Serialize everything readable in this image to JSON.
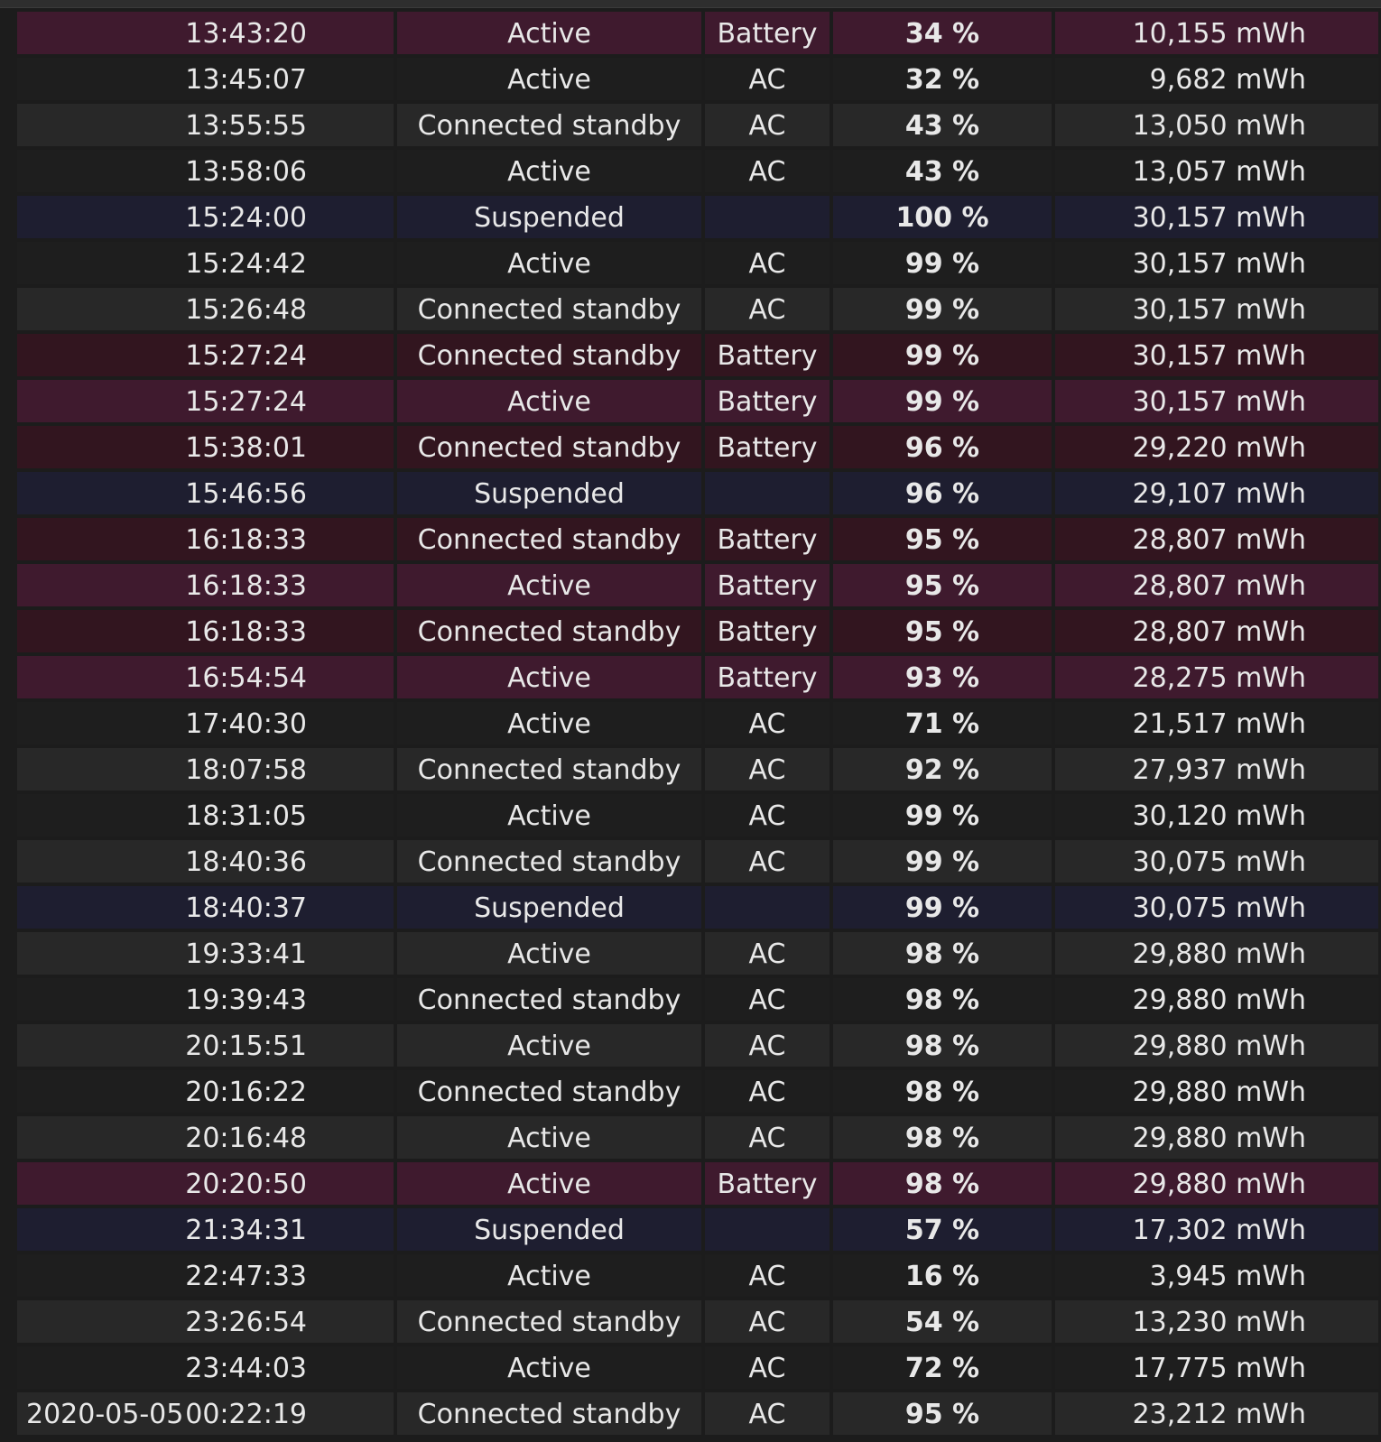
{
  "colors": {
    "battery_active": "#3f1a2e",
    "battery_standby": "#32151f",
    "suspended": "#1e1e30",
    "ac_light": "#282828",
    "ac_dark": "#1e1e1e",
    "text": "#e8e8e8"
  },
  "rows": [
    {
      "date": "",
      "time": "13:43:20",
      "state": "Active",
      "source": "Battery",
      "percent": "34 %",
      "capacity": "10,155 mWh"
    },
    {
      "date": "",
      "time": "13:45:07",
      "state": "Active",
      "source": "AC",
      "percent": "32 %",
      "capacity": "9,682 mWh"
    },
    {
      "date": "",
      "time": "13:55:55",
      "state": "Connected standby",
      "source": "AC",
      "percent": "43 %",
      "capacity": "13,050 mWh"
    },
    {
      "date": "",
      "time": "13:58:06",
      "state": "Active",
      "source": "AC",
      "percent": "43 %",
      "capacity": "13,057 mWh"
    },
    {
      "date": "",
      "time": "15:24:00",
      "state": "Suspended",
      "source": "",
      "percent": "100 %",
      "capacity": "30,157 mWh"
    },
    {
      "date": "",
      "time": "15:24:42",
      "state": "Active",
      "source": "AC",
      "percent": "99 %",
      "capacity": "30,157 mWh"
    },
    {
      "date": "",
      "time": "15:26:48",
      "state": "Connected standby",
      "source": "AC",
      "percent": "99 %",
      "capacity": "30,157 mWh"
    },
    {
      "date": "",
      "time": "15:27:24",
      "state": "Connected standby",
      "source": "Battery",
      "percent": "99 %",
      "capacity": "30,157 mWh"
    },
    {
      "date": "",
      "time": "15:27:24",
      "state": "Active",
      "source": "Battery",
      "percent": "99 %",
      "capacity": "30,157 mWh"
    },
    {
      "date": "",
      "time": "15:38:01",
      "state": "Connected standby",
      "source": "Battery",
      "percent": "96 %",
      "capacity": "29,220 mWh"
    },
    {
      "date": "",
      "time": "15:46:56",
      "state": "Suspended",
      "source": "",
      "percent": "96 %",
      "capacity": "29,107 mWh"
    },
    {
      "date": "",
      "time": "16:18:33",
      "state": "Connected standby",
      "source": "Battery",
      "percent": "95 %",
      "capacity": "28,807 mWh"
    },
    {
      "date": "",
      "time": "16:18:33",
      "state": "Active",
      "source": "Battery",
      "percent": "95 %",
      "capacity": "28,807 mWh"
    },
    {
      "date": "",
      "time": "16:18:33",
      "state": "Connected standby",
      "source": "Battery",
      "percent": "95 %",
      "capacity": "28,807 mWh"
    },
    {
      "date": "",
      "time": "16:54:54",
      "state": "Active",
      "source": "Battery",
      "percent": "93 %",
      "capacity": "28,275 mWh"
    },
    {
      "date": "",
      "time": "17:40:30",
      "state": "Active",
      "source": "AC",
      "percent": "71 %",
      "capacity": "21,517 mWh"
    },
    {
      "date": "",
      "time": "18:07:58",
      "state": "Connected standby",
      "source": "AC",
      "percent": "92 %",
      "capacity": "27,937 mWh"
    },
    {
      "date": "",
      "time": "18:31:05",
      "state": "Active",
      "source": "AC",
      "percent": "99 %",
      "capacity": "30,120 mWh"
    },
    {
      "date": "",
      "time": "18:40:36",
      "state": "Connected standby",
      "source": "AC",
      "percent": "99 %",
      "capacity": "30,075 mWh"
    },
    {
      "date": "",
      "time": "18:40:37",
      "state": "Suspended",
      "source": "",
      "percent": "99 %",
      "capacity": "30,075 mWh"
    },
    {
      "date": "",
      "time": "19:33:41",
      "state": "Active",
      "source": "AC",
      "percent": "98 %",
      "capacity": "29,880 mWh"
    },
    {
      "date": "",
      "time": "19:39:43",
      "state": "Connected standby",
      "source": "AC",
      "percent": "98 %",
      "capacity": "29,880 mWh"
    },
    {
      "date": "",
      "time": "20:15:51",
      "state": "Active",
      "source": "AC",
      "percent": "98 %",
      "capacity": "29,880 mWh"
    },
    {
      "date": "",
      "time": "20:16:22",
      "state": "Connected standby",
      "source": "AC",
      "percent": "98 %",
      "capacity": "29,880 mWh"
    },
    {
      "date": "",
      "time": "20:16:48",
      "state": "Active",
      "source": "AC",
      "percent": "98 %",
      "capacity": "29,880 mWh"
    },
    {
      "date": "",
      "time": "20:20:50",
      "state": "Active",
      "source": "Battery",
      "percent": "98 %",
      "capacity": "29,880 mWh"
    },
    {
      "date": "",
      "time": "21:34:31",
      "state": "Suspended",
      "source": "",
      "percent": "57 %",
      "capacity": "17,302 mWh"
    },
    {
      "date": "",
      "time": "22:47:33",
      "state": "Active",
      "source": "AC",
      "percent": "16 %",
      "capacity": "3,945 mWh"
    },
    {
      "date": "",
      "time": "23:26:54",
      "state": "Connected standby",
      "source": "AC",
      "percent": "54 %",
      "capacity": "13,230 mWh"
    },
    {
      "date": "",
      "time": "23:44:03",
      "state": "Active",
      "source": "AC",
      "percent": "72 %",
      "capacity": "17,775 mWh"
    },
    {
      "date": "2020-05-05",
      "time": "00:22:19",
      "state": "Connected standby",
      "source": "AC",
      "percent": "95 %",
      "capacity": "23,212 mWh"
    }
  ]
}
